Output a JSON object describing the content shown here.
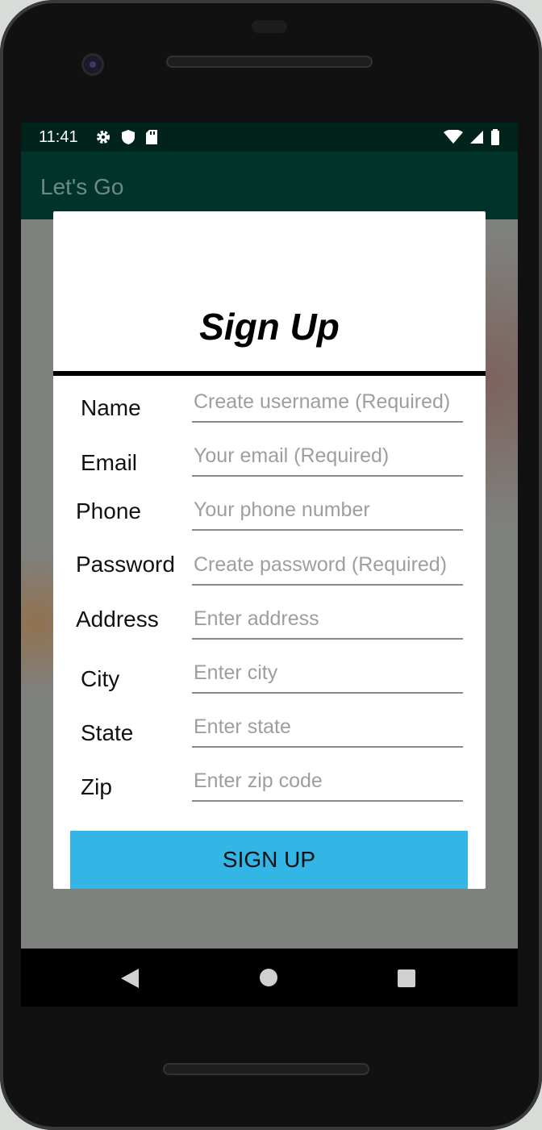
{
  "status_bar": {
    "time": "11:41",
    "icons_left": [
      "gear-icon",
      "shield-icon",
      "sd-card-icon"
    ],
    "icons_right": [
      "wifi-icon",
      "signal-icon",
      "battery-icon"
    ]
  },
  "app_bar": {
    "title": "Let's Go"
  },
  "dialog": {
    "title": "Sign Up",
    "fields": [
      {
        "label": "Name",
        "placeholder": "Create username (Required)"
      },
      {
        "label": "Email",
        "placeholder": "Your email (Required)"
      },
      {
        "label": "Phone",
        "placeholder": "Your phone number"
      },
      {
        "label": "Password",
        "placeholder": "Create password (Required)"
      },
      {
        "label": "Address",
        "placeholder": "Enter address"
      },
      {
        "label": "City",
        "placeholder": "Enter city"
      },
      {
        "label": "State",
        "placeholder": "Enter state"
      },
      {
        "label": "Zip",
        "placeholder": "Enter zip code"
      }
    ],
    "submit_label": "SIGN UP"
  },
  "nav_bar": {
    "icons": [
      "back-icon",
      "home-icon",
      "recents-icon"
    ]
  },
  "colors": {
    "app_bar": "#003329",
    "status_bar": "#00241c",
    "button": "#33b5e5"
  }
}
